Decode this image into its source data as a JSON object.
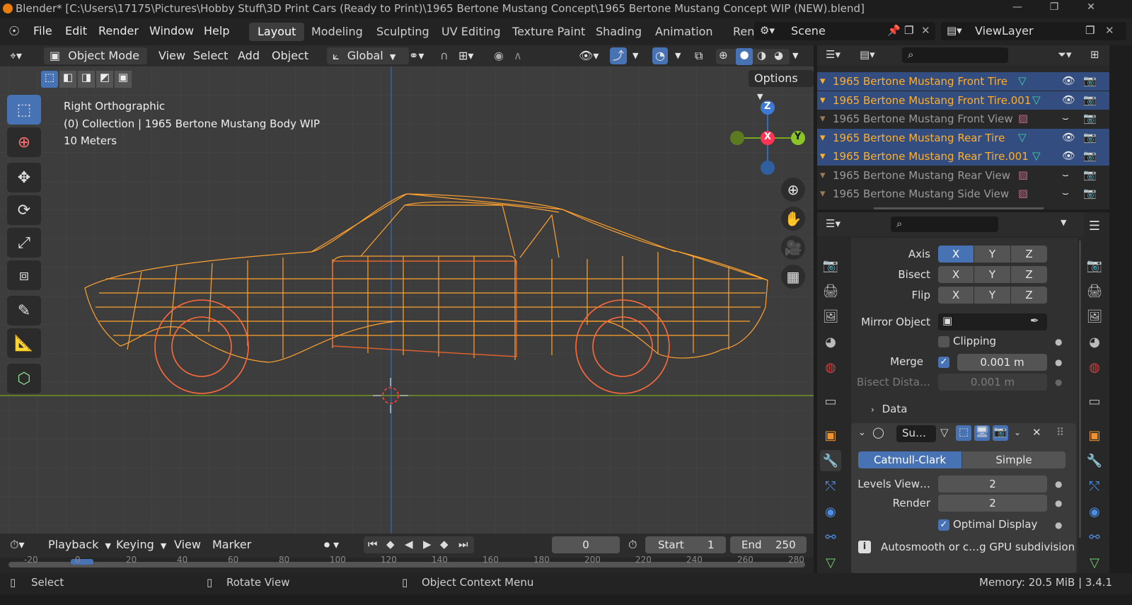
{
  "title_bar": {
    "text": "Blender* [C:\\Users\\17175\\Pictures\\Hobby Stuff\\3D Print Cars (Ready to Print)\\1965 Bertone Mustang Concept\\1965 Bertone Mustang Concept WIP (NEW).blend]"
  },
  "menu": {
    "file": "File",
    "edit": "Edit",
    "render": "Render",
    "window": "Window",
    "help": "Help"
  },
  "workspaces": [
    "Layout",
    "Modeling",
    "Sculpting",
    "UV Editing",
    "Texture Paint",
    "Shading",
    "Animation",
    "Ren"
  ],
  "scene": {
    "name": "Scene"
  },
  "view_layer": {
    "name": "ViewLayer"
  },
  "viewport_header": {
    "mode": "Object Mode",
    "view": "View",
    "select": "Select",
    "add": "Add",
    "object": "Object",
    "transform": "Global",
    "options": "Options"
  },
  "viewport_overlay": {
    "view_name": "Right Orthographic",
    "collection": "(0) Collection | 1965 Bertone Mustang Body WIP",
    "scale": "10 Meters"
  },
  "gizmo": {
    "z": "Z",
    "x": "X",
    "y": "Y"
  },
  "outliner": {
    "rows": [
      {
        "name": "1965 Bertone Mustang Front Tire",
        "selected": true
      },
      {
        "name": "1965 Bertone Mustang Front Tire.001",
        "selected": true
      },
      {
        "name": "1965 Bertone Mustang Front View",
        "selected": false
      },
      {
        "name": "1965 Bertone Mustang Rear Tire",
        "selected": true
      },
      {
        "name": "1965 Bertone Mustang Rear Tire.001",
        "selected": true
      },
      {
        "name": "1965 Bertone Mustang Rear View",
        "selected": false
      },
      {
        "name": "1965 Bertone Mustang Side View",
        "selected": false
      }
    ]
  },
  "properties": {
    "axis_label": "Axis",
    "bisect_label": "Bisect",
    "flip_label": "Flip",
    "x": "X",
    "y": "Y",
    "z": "Z",
    "mirror_object_label": "Mirror Object",
    "clipping_label": "Clipping",
    "merge_label": "Merge",
    "merge_value": "0.001 m",
    "bisect_distance_label": "Bisect Dista…",
    "bisect_distance_value": "0.001 m",
    "data_label": "Data",
    "subsurf_name": "Su…",
    "catmull_clark": "Catmull-Clark",
    "simple": "Simple",
    "levels_viewport_label": "Levels View…",
    "levels_viewport_value": "2",
    "render_label": "Render",
    "render_value": "2",
    "optimal_display_label": "Optimal Display",
    "info_text": "Autosmooth or c…g GPU subdivision"
  },
  "timeline": {
    "playback": "Playback",
    "keying": "Keying",
    "view": "View",
    "marker": "Marker",
    "current_frame": "0",
    "start_label": "Start",
    "start_value": "1",
    "end_label": "End",
    "end_value": "250",
    "ruler": [
      "-20",
      "0",
      "20",
      "40",
      "60",
      "80",
      "100",
      "120",
      "140",
      "160",
      "180",
      "200",
      "220",
      "240",
      "260",
      "280"
    ]
  },
  "status_bar": {
    "select": "Select",
    "rotate_view": "Rotate View",
    "context_menu": "Object Context Menu",
    "memory": "Memory: 20.5 MiB | 3.4.1"
  }
}
